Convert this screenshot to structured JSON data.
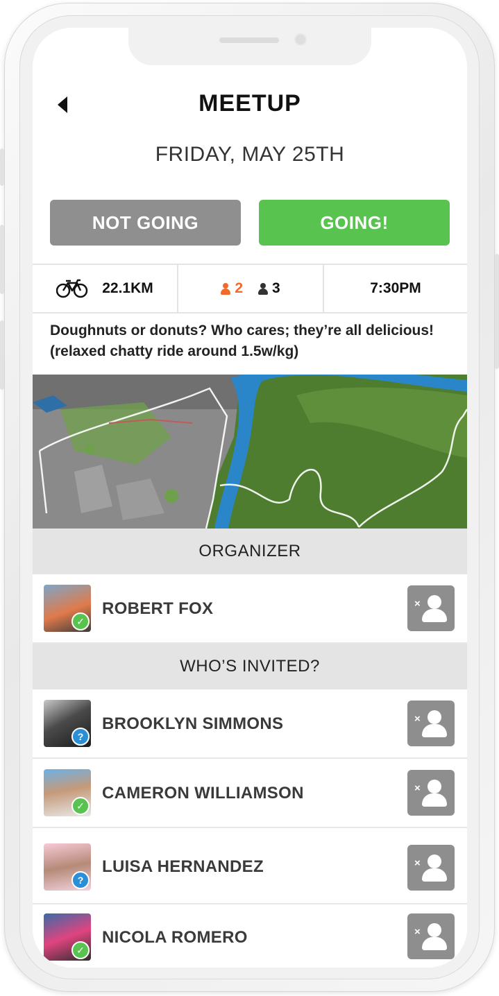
{
  "header": {
    "title": "MEETUP",
    "date": "FRIDAY, MAY 25TH"
  },
  "rsvp": {
    "not_going_label": "NOT GOING",
    "going_label": "GOING!"
  },
  "stats": {
    "distance": "22.1KM",
    "going_count": "2",
    "invited_count": "3",
    "time": "7:30PM"
  },
  "description": "Doughnuts or donuts? Who cares; they’re all delicious! (relaxed chatty ride around 1.5w/kg)",
  "sections": {
    "organizer": "ORGANIZER",
    "invited": "WHO’S INVITED?"
  },
  "organizer": {
    "name": "ROBERT FOX",
    "status": "going"
  },
  "invitees": [
    {
      "name": "BROOKLYN SIMMONS",
      "status": "unknown"
    },
    {
      "name": "CAMERON WILLIAMSON",
      "status": "going"
    },
    {
      "name": "LUISA HERNANDEZ",
      "status": "unknown"
    },
    {
      "name": "NICOLA ROMERO",
      "status": "going"
    }
  ],
  "colors": {
    "going": "#58c34f",
    "not_going": "#8f8f8f",
    "orange_accent": "#f26a2b",
    "unknown_badge": "#2b8fd8"
  },
  "icons": {
    "back": "back-arrow-icon",
    "distance": "bicycle-icon",
    "going": "person-orange-icon",
    "invited": "person-dark-icon",
    "remove": "remove-user-icon"
  }
}
